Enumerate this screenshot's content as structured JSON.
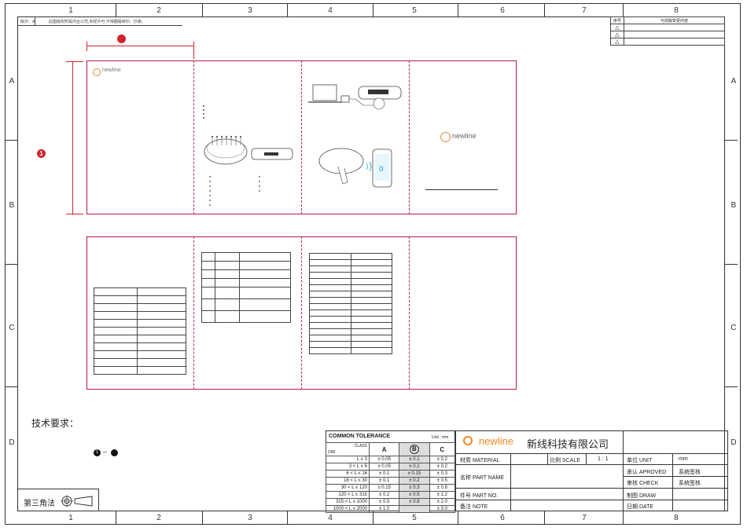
{
  "top_note": {
    "version": "版次：A",
    "copyright": "此图版权所属鸿合公司,未经许可,不得翻版转印、抄袭。"
  },
  "zones": {
    "cols": [
      "1",
      "2",
      "3",
      "4",
      "5",
      "6",
      "7",
      "8"
    ],
    "rows": [
      "A",
      "B",
      "C",
      "D"
    ]
  },
  "revision": {
    "header_no": "序号",
    "header_content": "与前版变更内容",
    "marks": [
      "△",
      "△",
      "△"
    ]
  },
  "dimension_markers": {
    "horizontal": "",
    "vertical": "1"
  },
  "brand": {
    "small_logo": "newline",
    "center_logo": "newline"
  },
  "tech_req": {
    "title": "技术要求：",
    "item_left": "1",
    "item_sep": "–"
  },
  "projection": {
    "label": "第三角法"
  },
  "tolerance": {
    "title": "COMMON TOLERANCE",
    "unit": "Unit : mm",
    "corner_top": "CLASS",
    "corner_bottom": "DIM",
    "cols": [
      "A",
      "B",
      "C"
    ],
    "rows": [
      {
        "dim": "L ≤ 3",
        "a": "± 0.05",
        "b": "± 0.1",
        "c": "± 0.2"
      },
      {
        "dim": "3 < L ≤ 6",
        "a": "± 0.05",
        "b": "± 0.1",
        "c": "± 0.2"
      },
      {
        "dim": "6 < L ≤ 16",
        "a": "± 0.1",
        "b": "± 0.15",
        "c": "± 0.3"
      },
      {
        "dim": "16 < L ≤ 30",
        "a": "± 0.1",
        "b": "± 0.2",
        "c": "± 0.5"
      },
      {
        "dim": "30 < L ≤ 120",
        "a": "± 0.15",
        "b": "± 0.3",
        "c": "± 0.8"
      },
      {
        "dim": "120 < L ≤ 315",
        "a": "± 0.2",
        "b": "± 0.5",
        "c": "± 1.2"
      },
      {
        "dim": "315 < L ≤ 1000",
        "a": "± 0.5",
        "b": "± 0.8",
        "c": "± 2.0"
      },
      {
        "dim": "1000 < L ≤ 2000",
        "a": "± 1.0",
        "b": "",
        "c": "± 3.0"
      }
    ]
  },
  "title_block": {
    "logo": "newline",
    "company": "新线科技有限公司",
    "material_label": "材质 MATERIAL",
    "scale_label": "比例 SCALE",
    "scale_value": "1 : 1",
    "unit_label": "单位 UNIT",
    "unit_value": "mm",
    "approved_label": "承认 APROVED",
    "approved_value": "系统签核",
    "part_name_label": "名称 PART NAME",
    "check_label": "审核 CHECK",
    "check_value": "系统签核",
    "part_no_label": "件号 PART NO.",
    "draw_label": "制图 DRAW",
    "remark_label": "备注 NOTE",
    "date_label": "日期 DATE"
  }
}
